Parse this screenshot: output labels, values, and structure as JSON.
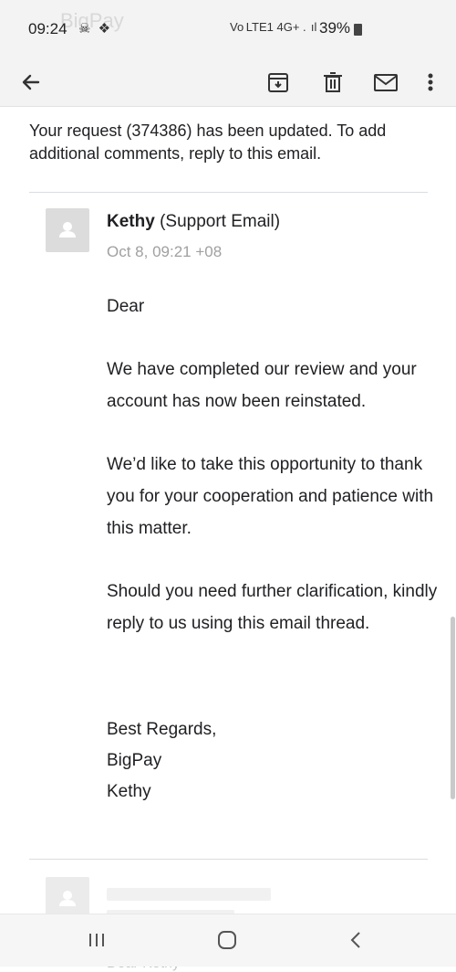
{
  "status_bar": {
    "time": "09:24",
    "left_icons": "☠ ❖",
    "watermark": "BigPay",
    "network": "Vo LTE1 4G+ .  ıl",
    "battery": "39%"
  },
  "toolbar": {
    "back_icon": "arrow-left-icon",
    "archive_icon": "archive-icon",
    "delete_icon": "trash-icon",
    "mark_unread_icon": "mail-icon",
    "more_icon": "more-vertical-icon"
  },
  "intro_text": "Your request (374386) has been updated. To add additional comments, reply to this email.",
  "message": {
    "sender_name": "Kethy",
    "sender_detail": " (Support Email)",
    "date": "Oct 8, 09:21 +08",
    "greeting": "Dear",
    "paragraph1": "We have completed our review and your account has now been reinstated.",
    "paragraph2": "We’d like to take this opportunity to thank you for your cooperation and patience with this matter.",
    "paragraph3": "Should you need further clarification, kindly reply to us using this email thread.",
    "signoff": "Best Regards,",
    "sign_company": "BigPay",
    "sign_name": "Kethy"
  },
  "next_message_preview": "Dear Kethy",
  "navigation": {
    "recents_icon": "recents-icon",
    "home_icon": "home-icon",
    "back_icon": "nav-back-icon"
  }
}
